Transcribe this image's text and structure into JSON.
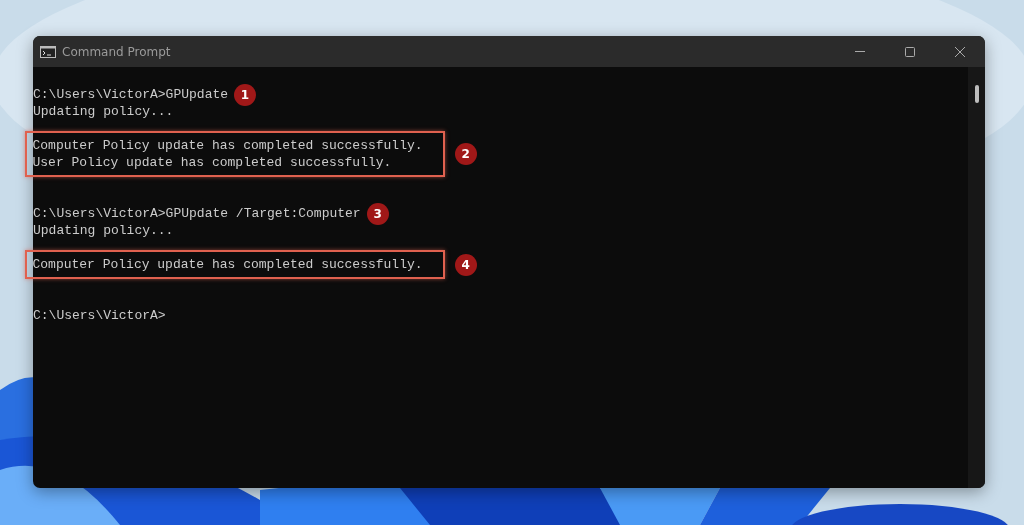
{
  "window": {
    "title": "Command Prompt"
  },
  "console": {
    "blocks": [
      {
        "highlighted": false,
        "lines": [
          {
            "text": "C:\\Users\\VictorA>GPUpdate",
            "callout": "1"
          },
          {
            "text": "Updating policy..."
          }
        ]
      },
      {
        "highlighted": true,
        "callout": "2",
        "lines": [
          {
            "text": "Computer Policy update has completed successfully."
          },
          {
            "text": "User Policy update has completed successfully."
          }
        ]
      },
      {
        "highlighted": false,
        "lines": [
          {
            "text": "C:\\Users\\VictorA>GPUpdate /Target:Computer",
            "callout": "3"
          },
          {
            "text": "Updating policy..."
          }
        ]
      },
      {
        "highlighted": true,
        "callout": "4",
        "lines": [
          {
            "text": "Computer Policy update has completed successfully."
          }
        ]
      },
      {
        "highlighted": false,
        "lines": [
          {
            "text": "C:\\Users\\VictorA>"
          }
        ]
      }
    ]
  }
}
